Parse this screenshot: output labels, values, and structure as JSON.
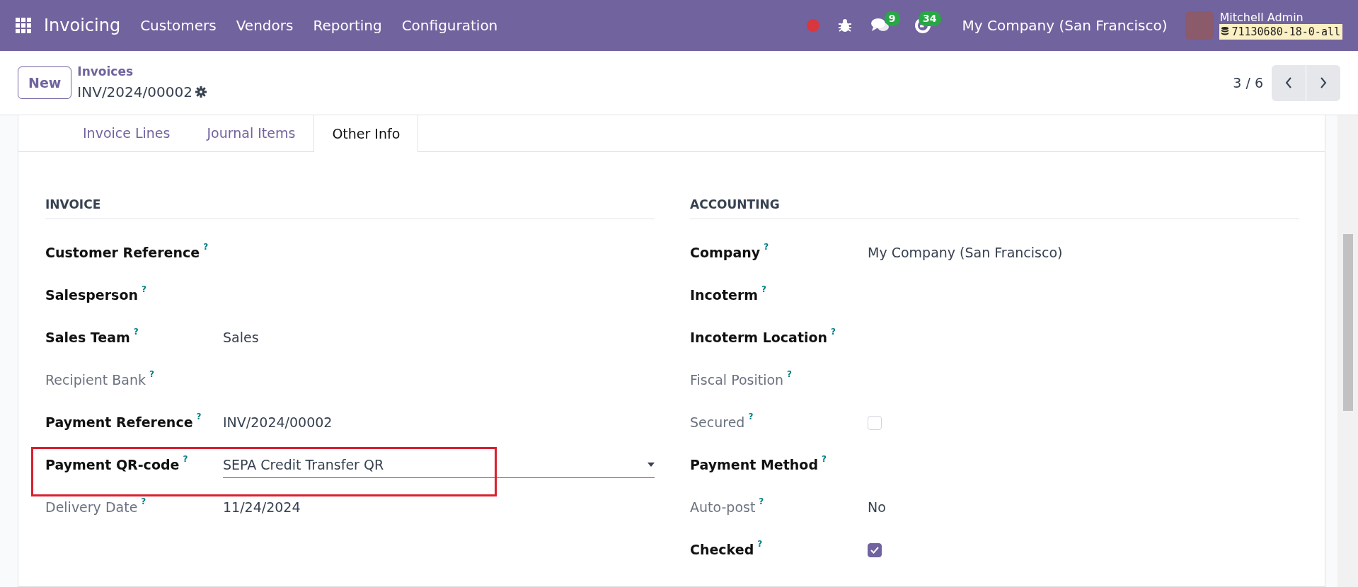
{
  "navbar": {
    "app_name": "Invoicing",
    "menu": [
      "Customers",
      "Vendors",
      "Reporting",
      "Configuration"
    ],
    "messages_count": "9",
    "activities_count": "34",
    "company": "My Company (San Francisco)",
    "user": "Mitchell Admin",
    "database": "71130680-18-0-all"
  },
  "control_panel": {
    "new_button": "New",
    "breadcrumb": "Invoices",
    "record": "INV/2024/00002",
    "pager": "3 / 6"
  },
  "tabs": [
    {
      "label": "Invoice Lines",
      "selected": false
    },
    {
      "label": "Journal Items",
      "selected": false
    },
    {
      "label": "Other Info",
      "selected": true
    }
  ],
  "sections": [
    {
      "title": "INVOICE",
      "fields": [
        {
          "label": "Customer Reference",
          "help": "?",
          "muted": false,
          "kind": "text"
        },
        {
          "label": "Salesperson",
          "help": "?",
          "muted": false,
          "kind": "text"
        },
        {
          "label": "Sales Team",
          "help": "?",
          "muted": false,
          "kind": "text",
          "value": "Sales"
        },
        {
          "label": "Recipient Bank",
          "help": "?",
          "muted": true,
          "kind": "text"
        },
        {
          "label": "Payment Reference",
          "help": "?",
          "muted": false,
          "kind": "text",
          "value": "INV/2024/00002"
        },
        {
          "label": "Payment QR-code",
          "help": "?",
          "muted": false,
          "kind": "select",
          "value": "SEPA Credit Transfer QR",
          "highlighted": true
        },
        {
          "label": "Delivery Date",
          "help": "?",
          "muted": true,
          "kind": "text",
          "value": "11/24/2024"
        }
      ]
    },
    {
      "title": "ACCOUNTING",
      "fields": [
        {
          "label": "Company",
          "help": "?",
          "muted": false,
          "kind": "text",
          "value": "My Company (San Francisco)"
        },
        {
          "label": "Incoterm",
          "help": "?",
          "muted": false,
          "kind": "text"
        },
        {
          "label": "Incoterm Location",
          "help": "?",
          "muted": false,
          "kind": "text"
        },
        {
          "label": "Fiscal Position",
          "help": "?",
          "muted": true,
          "kind": "text"
        },
        {
          "label": "Secured",
          "help": "?",
          "muted": true,
          "kind": "checkbox",
          "checked": false
        },
        {
          "label": "Payment Method",
          "help": "?",
          "muted": false,
          "kind": "text"
        },
        {
          "label": "Auto-post",
          "help": "?",
          "muted": true,
          "kind": "text",
          "value": "No"
        },
        {
          "label": "Checked",
          "help": "?",
          "muted": false,
          "kind": "checkbox",
          "checked": true
        }
      ]
    }
  ]
}
